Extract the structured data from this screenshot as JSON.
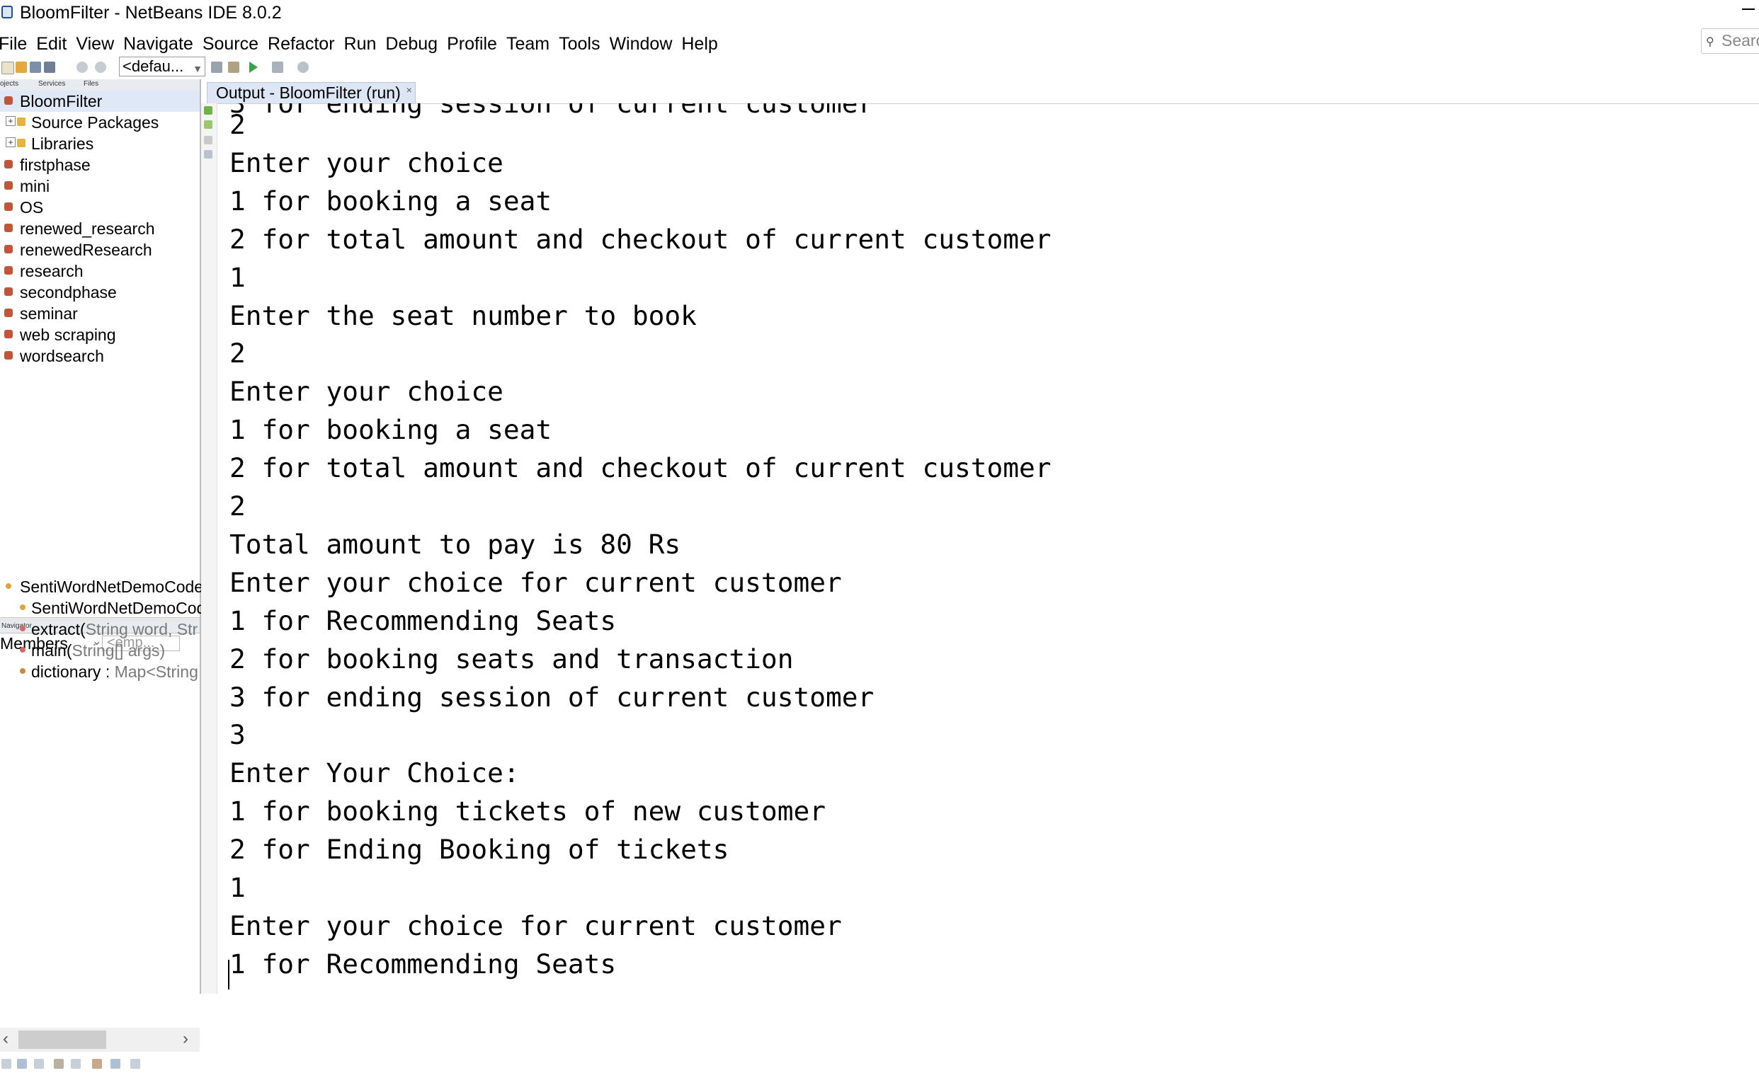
{
  "window": {
    "title": "BloomFilter - NetBeans IDE 8.0.2"
  },
  "menu": [
    "File",
    "Edit",
    "View",
    "Navigate",
    "Source",
    "Refactor",
    "Run",
    "Debug",
    "Profile",
    "Team",
    "Tools",
    "Window",
    "Help"
  ],
  "search": {
    "placeholder": "Search"
  },
  "toolbar": {
    "config_value": "<defau..."
  },
  "projects_panel": {
    "tabs": [
      "Projects",
      "Services",
      "Files"
    ],
    "items": [
      {
        "label": "BloomFilter",
        "kind": "project"
      },
      {
        "label": "Source Packages",
        "kind": "package"
      },
      {
        "label": "Libraries",
        "kind": "library"
      },
      {
        "label": "firstphase",
        "kind": "project"
      },
      {
        "label": "mini",
        "kind": "project"
      },
      {
        "label": "OS",
        "kind": "project"
      },
      {
        "label": "renewed_research",
        "kind": "project"
      },
      {
        "label": "renewedResearch",
        "kind": "project"
      },
      {
        "label": "research",
        "kind": "project"
      },
      {
        "label": "secondphase",
        "kind": "project"
      },
      {
        "label": "seminar",
        "kind": "project"
      },
      {
        "label": "web scraping",
        "kind": "project"
      },
      {
        "label": "wordsearch",
        "kind": "project"
      }
    ]
  },
  "navigator": {
    "tab": "Navigator",
    "members_label": "Members",
    "filter_placeholder": "<emp...",
    "items": [
      {
        "name": "SentiWordNetDemoCode",
        "detail": ""
      },
      {
        "name": "SentiWordNetDemoCod",
        "detail": ""
      },
      {
        "name": "extract(",
        "detail": "String word, Str"
      },
      {
        "name": "main(",
        "detail": "String[] args)"
      },
      {
        "name": "dictionary : ",
        "detail": "Map<String"
      }
    ]
  },
  "output": {
    "tab_label": "Output - BloomFilter (run)",
    "partial_top_line": "3 for ending session of current customer",
    "lines": [
      "2",
      "Enter your choice",
      "1 for booking a seat",
      "2 for total amount and checkout of current customer",
      "1",
      "Enter the seat number to book",
      "2",
      "Enter your choice",
      "1 for booking a seat",
      "2 for total amount and checkout of current customer",
      "2",
      "Total amount to pay is 80 Rs",
      "Enter your choice for current customer",
      "1 for Recommending Seats",
      "2 for booking seats and transaction",
      "3 for ending session of current customer",
      "3",
      "Enter Your Choice:",
      "1 for booking tickets of new customer",
      "2 for Ending Booking of tickets",
      "1",
      "Enter your choice for current customer",
      "1 for Recommending Seats"
    ]
  }
}
